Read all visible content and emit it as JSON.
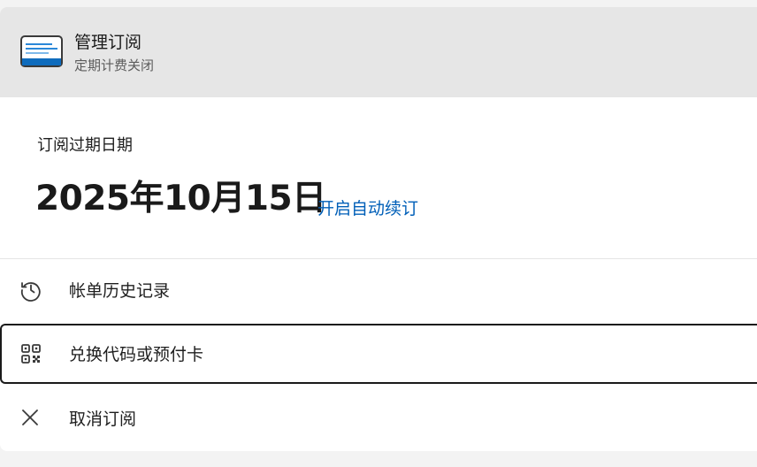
{
  "header": {
    "title": "管理订阅",
    "subtitle": "定期计费关闭",
    "icon": "subscription-card-icon"
  },
  "expiry": {
    "label": "订阅过期日期",
    "date": "2025年10月15日",
    "auto_renew_link": "开启自动续订"
  },
  "menu": {
    "items": [
      {
        "label": "帐单历史记录",
        "icon": "history-icon"
      },
      {
        "label": "兑换代码或预付卡",
        "icon": "qr-code-icon"
      },
      {
        "label": "取消订阅",
        "icon": "close-icon"
      }
    ]
  },
  "colors": {
    "accent": "#005fb8",
    "header_bg": "#e6e6e6",
    "card_bg": "#ffffff"
  }
}
